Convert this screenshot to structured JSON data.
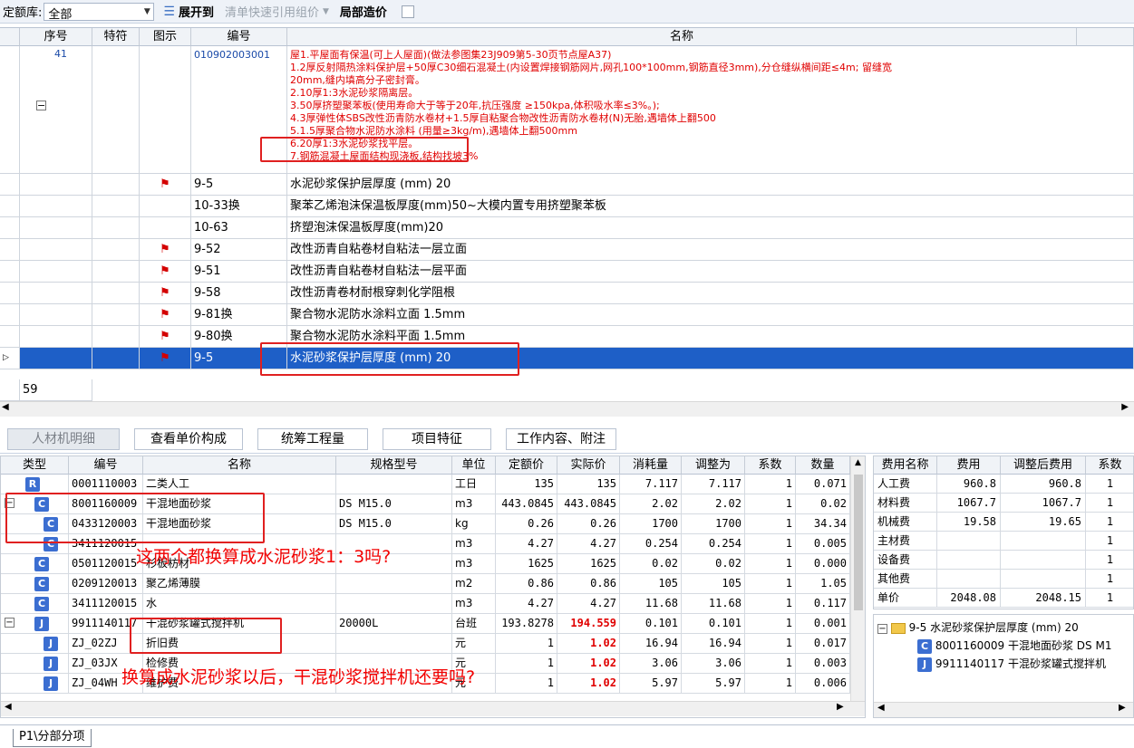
{
  "toolbar": {
    "quota_label": "定额库:",
    "quota_value": "全部",
    "expand_label": "展开到",
    "quick_ref_label": "清单快速引用组价",
    "local_price_label": "局部造价"
  },
  "main_grid": {
    "headers": [
      "序号",
      "特符",
      "图示",
      "编号",
      "名称"
    ],
    "bill": {
      "seq": "41",
      "code": "010902003001",
      "desc_lines": [
        "屋1.平屋面有保温(可上人屋面)(做法参图集23J909第5-30页节点屋A37)",
        "1.2厚反射隔热涂料保护层+50厚C30细石混凝土(内设置焊接钢筋网片,网孔100*100mm,钢筋直径3mm),分仓缝纵横间距≤4m; 留缝宽",
        "20mm,缝内填高分子密封膏。",
        "2.10厚1:3水泥砂浆隔离层。",
        "3.50厚挤塑聚苯板(使用寿命大于等于20年,抗压强度 ≥150kpa,体积吸水率≤3%。);",
        "4.3厚弹性体SBS改性沥青防水卷材+1.5厚自粘聚合物改性沥青防水卷材(N)无胎,遇墙体上翻500",
        "5.1.5厚聚合物水泥防水涂料 (用量≥3kg/m),遇墙体上翻500mm",
        "6.20厚1:3水泥砂浆找平层。",
        "7.钢筋混凝土屋面结构现浇板,结构找坡3%"
      ]
    },
    "rows": [
      {
        "code": "9-5",
        "name": "水泥砂浆保护层厚度 (mm) 20",
        "flag": true
      },
      {
        "code": "10-33换",
        "name": "聚苯乙烯泡沫保温板厚度(mm)50~大模内置专用挤塑聚苯板",
        "flag": false
      },
      {
        "code": "10-63",
        "name": "挤塑泡沫保温板厚度(mm)20",
        "flag": false
      },
      {
        "code": "9-52",
        "name": "改性沥青自粘卷材自粘法一层立面",
        "flag": true
      },
      {
        "code": "9-51",
        "name": "改性沥青自粘卷材自粘法一层平面",
        "flag": true
      },
      {
        "code": "9-58",
        "name": "改性沥青卷材耐根穿刺化学阻根",
        "flag": true
      },
      {
        "code": "9-81换",
        "name": "聚合物水泥防水涂料立面 1.5mm",
        "flag": true
      },
      {
        "code": "9-80换",
        "name": "聚合物水泥防水涂料平面 1.5mm",
        "flag": true
      },
      {
        "code": "9-5",
        "name": "水泥砂浆保护层厚度 (mm) 20",
        "flag": true
      }
    ],
    "next_seq": "59"
  },
  "tabs": [
    "人材机明细",
    "查看单价构成",
    "统筹工程量",
    "项目特征",
    "工作内容、附注"
  ],
  "detail": {
    "headers": [
      "类型",
      "编号",
      "名称",
      "规格型号",
      "单位",
      "定额价",
      "实际价",
      "消耗量",
      "调整为",
      "系数",
      "数量"
    ],
    "rows": [
      {
        "type": "R",
        "code": "0001110003",
        "name": "二类人工",
        "spec": "",
        "unit": "工日",
        "quota": "135",
        "actual": "135",
        "consume": "7.117",
        "adjust": "7.117",
        "coef": "1",
        "qty": "0.071"
      },
      {
        "type": "C",
        "code": "8001160009",
        "name": "干混地面砂浆",
        "spec": "DS M15.0",
        "unit": "m3",
        "quota": "443.0845",
        "actual": "443.0845",
        "consume": "2.02",
        "adjust": "2.02",
        "coef": "1",
        "qty": "0.02"
      },
      {
        "type": "C",
        "code": "0433120003",
        "name": "干混地面砂浆",
        "spec": "DS M15.0",
        "unit": "kg",
        "quota": "0.26",
        "actual": "0.26",
        "consume": "1700",
        "adjust": "1700",
        "coef": "1",
        "qty": "34.34"
      },
      {
        "type": "C",
        "code": "3411120015",
        "name": "",
        "spec": "",
        "unit": "m3",
        "quota": "4.27",
        "actual": "4.27",
        "consume": "0.254",
        "adjust": "0.254",
        "coef": "1",
        "qty": "0.005"
      },
      {
        "type": "C",
        "code": "0501120015",
        "name": "杉板枋材",
        "spec": "",
        "unit": "m3",
        "quota": "1625",
        "actual": "1625",
        "consume": "0.02",
        "adjust": "0.02",
        "coef": "1",
        "qty": "0.000"
      },
      {
        "type": "C",
        "code": "0209120013",
        "name": "聚乙烯薄膜",
        "spec": "",
        "unit": "m2",
        "quota": "0.86",
        "actual": "0.86",
        "consume": "105",
        "adjust": "105",
        "coef": "1",
        "qty": "1.05"
      },
      {
        "type": "C",
        "code": "3411120015",
        "name": "水",
        "spec": "",
        "unit": "m3",
        "quota": "4.27",
        "actual": "4.27",
        "consume": "11.68",
        "adjust": "11.68",
        "coef": "1",
        "qty": "0.117"
      },
      {
        "type": "J",
        "code": "9911140117",
        "name": "干混砂浆罐式搅拌机",
        "spec": "20000L",
        "unit": "台班",
        "quota": "193.8278",
        "actual": "194.559",
        "consume": "0.101",
        "adjust": "0.101",
        "coef": "1",
        "qty": "0.001"
      },
      {
        "type": "J",
        "code": "ZJ_02ZJ",
        "name": "折旧费",
        "spec": "",
        "unit": "元",
        "quota": "1",
        "actual": "1.02",
        "consume": "16.94",
        "adjust": "16.94",
        "coef": "1",
        "qty": "0.017"
      },
      {
        "type": "J",
        "code": "ZJ_03JX",
        "name": "检修费",
        "spec": "",
        "unit": "元",
        "quota": "1",
        "actual": "1.02",
        "consume": "3.06",
        "adjust": "3.06",
        "coef": "1",
        "qty": "0.003"
      },
      {
        "type": "J",
        "code": "ZJ_04WH",
        "name": "维护费",
        "spec": "",
        "unit": "元",
        "quota": "1",
        "actual": "1.02",
        "consume": "5.97",
        "adjust": "5.97",
        "coef": "1",
        "qty": "0.006"
      }
    ]
  },
  "fees": {
    "headers": [
      "费用名称",
      "费用",
      "调整后费用",
      "系数"
    ],
    "rows": [
      {
        "name": "人工费",
        "fee": "960.8",
        "adj": "960.8",
        "coef": "1"
      },
      {
        "name": "材料费",
        "fee": "1067.7",
        "adj": "1067.7",
        "coef": "1"
      },
      {
        "name": "机械费",
        "fee": "19.58",
        "adj": "19.65",
        "coef": "1"
      },
      {
        "name": "主材费",
        "fee": "",
        "adj": "",
        "coef": "1"
      },
      {
        "name": "设备费",
        "fee": "",
        "adj": "",
        "coef": "1"
      },
      {
        "name": "其他费",
        "fee": "",
        "adj": "",
        "coef": "1"
      },
      {
        "name": "单价",
        "fee": "2048.08",
        "adj": "2048.15",
        "coef": "1"
      }
    ]
  },
  "tree": {
    "root": "9-5 水泥砂浆保护层厚度 (mm) 20",
    "child1": "8001160009 干混地面砂浆 DS M1",
    "child2": "9911140117 干混砂浆罐式搅拌机"
  },
  "annotations": {
    "q1": "这两个都换算成水泥砂浆1：3吗?",
    "q2": "换算成水泥砂浆以后，干混砂浆搅拌机还要吗?"
  },
  "status": {
    "sheet_tab": "P1\\分部分项"
  },
  "colors": {
    "selected_row": "#1e5fc7",
    "annotation_red": "#f20000",
    "badge_blue": "#3b6ed1"
  }
}
